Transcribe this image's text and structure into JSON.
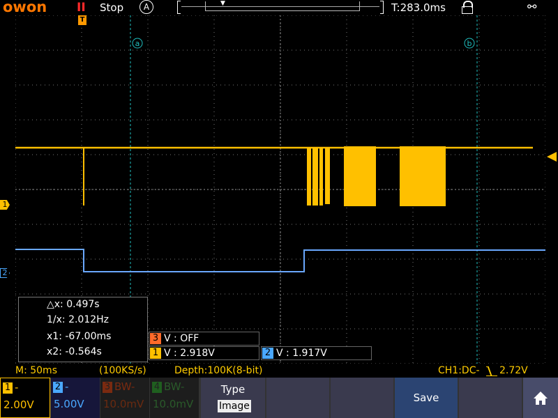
{
  "brand": {
    "logo": "owon"
  },
  "header": {
    "run_icon": "II",
    "run_status": "Stop",
    "trigger_mode": "A",
    "trigger_time": "T:283.0ms",
    "icons": [
      "lock-icon",
      "usb-icon"
    ]
  },
  "cursors": {
    "a_label": "a",
    "b_label": "b",
    "dx": "△x: 0.497s",
    "inv_dx": "1/x: 2.012Hz",
    "x1": "x1: -67.00ms",
    "x2": "x2: -0.564s"
  },
  "markers": {
    "trigger": "T",
    "ch1": "1",
    "ch2": "2"
  },
  "measurements": {
    "v3": {
      "tag": "3",
      "text": "V : OFF"
    },
    "v1": {
      "tag": "1",
      "text": "V : 2.918V"
    },
    "v2": {
      "tag": "2",
      "text": "V : 1.917V"
    }
  },
  "status": {
    "timebase": "M: 50ms",
    "sample_rate": "(100KS/s)",
    "depth": "Depth:100K(8-bit)",
    "trigger": "CH1:DC-",
    "trigger_level": "2.72V"
  },
  "channels": [
    {
      "num": "1",
      "coupling": "-",
      "scale": "2.00V",
      "color": "#ffc000"
    },
    {
      "num": "2",
      "coupling": "-",
      "scale": "5.00V",
      "color": "#4aa8ff"
    },
    {
      "num": "3",
      "coupling": "BW-",
      "scale": "10.0mV",
      "color": "#8a2a0a"
    },
    {
      "num": "4",
      "coupling": "BW-",
      "scale": "10.0mV",
      "color": "#1f5f1f"
    }
  ],
  "menu": {
    "type_label": "Type",
    "type_value": "Image",
    "save_label": "Save",
    "home_icon": "home-icon"
  },
  "colors": {
    "ch1": "#ffc000",
    "ch2": "#6aa8ff",
    "cursor": "#20c0c0",
    "brand": "#ff7700"
  }
}
